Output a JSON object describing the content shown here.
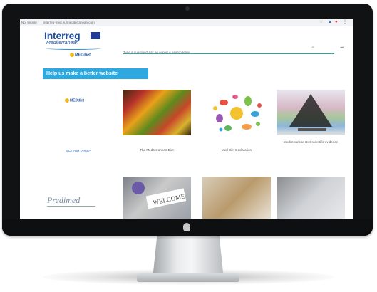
{
  "browser": {
    "security": "Not secure",
    "url": "interreg-med.eu/mediterranean.com"
  },
  "header": {
    "logo_title": "Interreg",
    "logo_subtitle": "Mediterranean",
    "medidiet_label": "MEDdiet",
    "search_placeholder": "Type a question? Ask an expert & search terms"
  },
  "banner": {
    "label": "Help us make a better website"
  },
  "tiles": [
    {
      "caption": "The Mediterranean Diet"
    },
    {
      "caption": "Med Diet Declaration"
    },
    {
      "caption": "Mediterranean Diet scientific evidence"
    }
  ],
  "left_column": {
    "medidiet_logo": "MEDdiet",
    "project_label": "MEDdiet Project",
    "predimed_logo": "Predimed"
  },
  "colors": {
    "accent": "#2fa8e0",
    "brand_blue": "#1f4e9c",
    "search_underline": "#20a7a7"
  },
  "icons": [
    "search-icon",
    "menu-icon",
    "star-icon",
    "account-icon",
    "apple-logo-icon"
  ]
}
